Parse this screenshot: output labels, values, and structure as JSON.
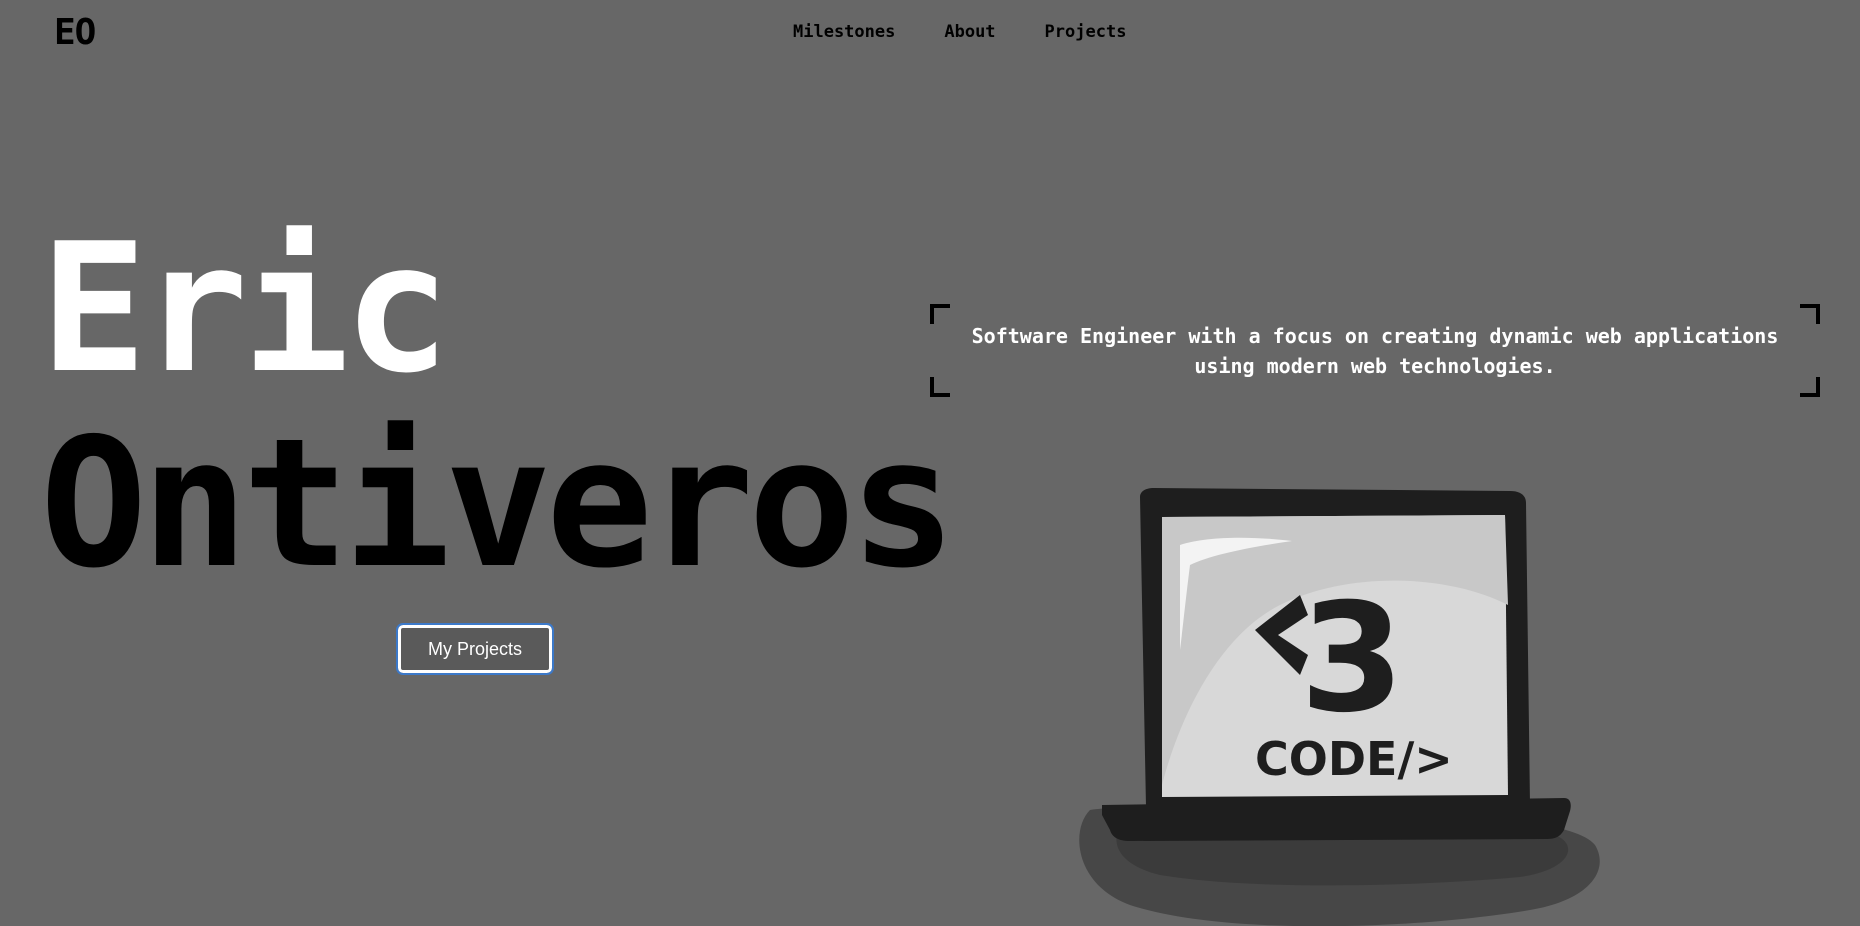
{
  "header": {
    "logo": "EO",
    "nav": [
      {
        "label": "Milestones"
      },
      {
        "label": "About"
      },
      {
        "label": "Projects"
      }
    ]
  },
  "hero": {
    "first_name": "Eric",
    "last_name": "Ontiveros",
    "cta_label": "My Projects",
    "tagline": "Software Engineer with a focus on creating dynamic web applications using modern web technologies."
  },
  "illustration": {
    "icon": "laptop-heart-code-icon",
    "screen_heart": "<3",
    "screen_code": "CODE/>"
  },
  "colors": {
    "background": "#676767",
    "first_name": "#ffffff",
    "last_name": "#000000",
    "focus_ring": "#3c79c9"
  }
}
